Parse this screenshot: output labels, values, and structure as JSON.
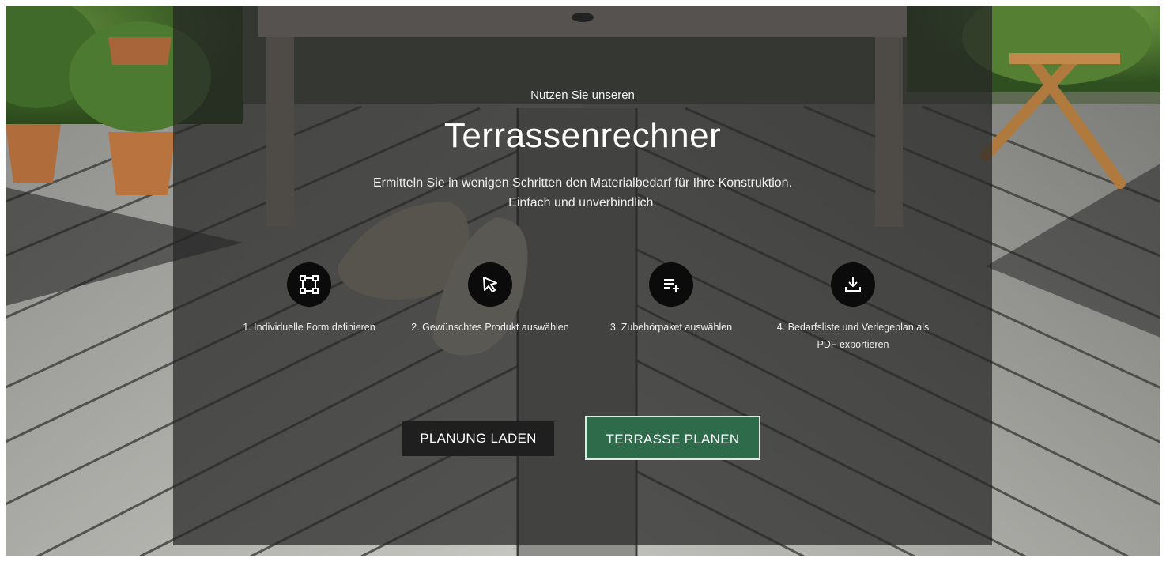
{
  "hero": {
    "subtitle": "Nutzen Sie unseren",
    "title": "Terrassenrechner",
    "description": "Ermitteln Sie in wenigen Schritten den Materialbedarf für Ihre Konstruktion. Einfach und unverbindlich."
  },
  "steps": [
    {
      "icon": "shape-icon",
      "label": "1. Individuelle Form definieren"
    },
    {
      "icon": "cursor-icon",
      "label": "2. Gewünschtes Produkt auswählen"
    },
    {
      "icon": "playlist-add-icon",
      "label": "3. Zubehörpaket auswählen"
    },
    {
      "icon": "download-icon",
      "label": "4. Bedarfsliste und Verlegeplan als PDF exportieren"
    }
  ],
  "buttons": {
    "load_label": "PLANUNG LADEN",
    "plan_label": "TERRASSE PLANEN"
  },
  "colors": {
    "accent_green": "#2d6b4b",
    "overlay": "#262626",
    "icon_bg": "#0b0b0b"
  }
}
